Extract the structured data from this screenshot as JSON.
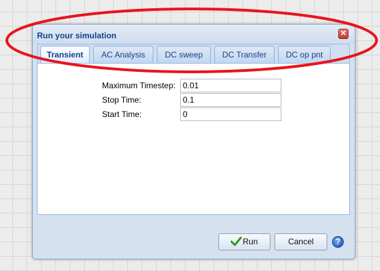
{
  "dialog": {
    "title": "Run your simulation",
    "close_glyph": "✕"
  },
  "tabs": [
    {
      "label": "Transient",
      "active": true
    },
    {
      "label": "AC Analysis",
      "active": false
    },
    {
      "label": "DC sweep",
      "active": false
    },
    {
      "label": "DC Transfer",
      "active": false
    },
    {
      "label": "DC op pnt",
      "active": false
    }
  ],
  "form": {
    "fields": [
      {
        "label": "Maximum Timestep:",
        "value": "0.01"
      },
      {
        "label": "Stop Time:",
        "value": "0.1"
      },
      {
        "label": "Start Time:",
        "value": "0"
      }
    ]
  },
  "buttons": {
    "run_label": "Run",
    "cancel_label": "Cancel",
    "help_glyph": "?"
  },
  "icons": {
    "close": "close-icon",
    "run": "check-icon",
    "help": "help-icon"
  },
  "colors": {
    "annotation_ellipse": "#e8141c",
    "title_text": "#15428b"
  }
}
